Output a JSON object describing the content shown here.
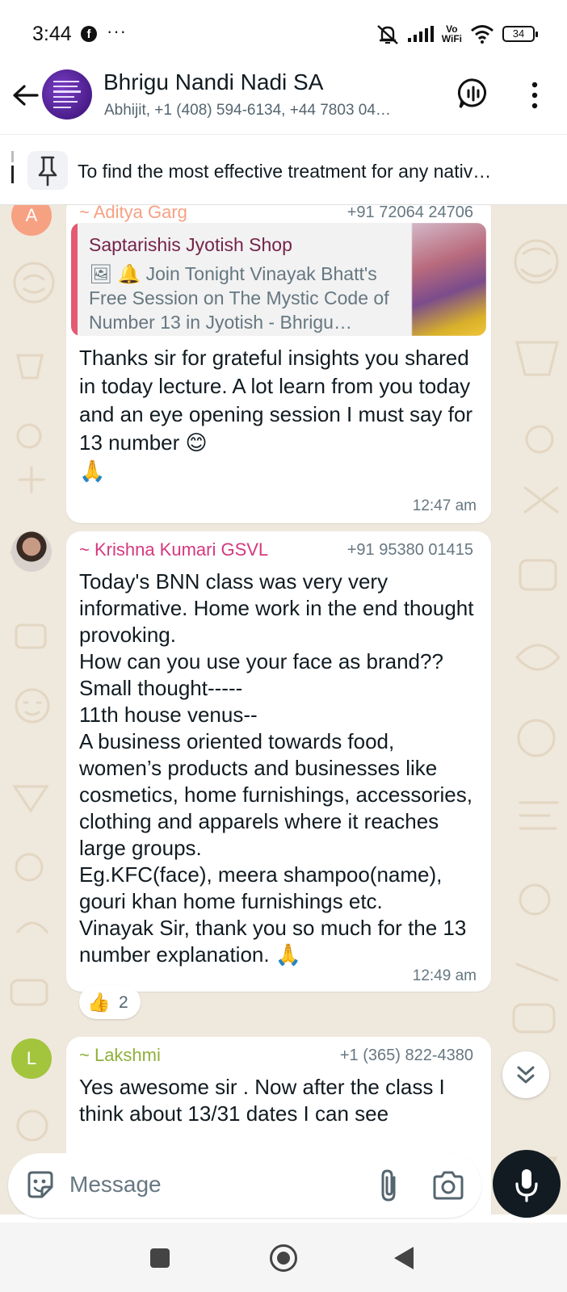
{
  "status_bar": {
    "time": "3:44",
    "app_badge": "f",
    "overflow": "···",
    "vowifi_top": "Vo",
    "vowifi_bottom": "WiFi",
    "battery": "34"
  },
  "header": {
    "title": "Bhrigu Nandi Nadi SA",
    "subtitle": "Abhijit, +1 (408) 594-6134, +44 7803 04…"
  },
  "pinned": {
    "text": "To find the most effective treatment for any nativ…"
  },
  "messages": [
    {
      "avatar_letter": "A",
      "avatar_color": "#f7a183",
      "sender": "~ Aditya Garg",
      "sender_color": "#f7a183",
      "phone": "+91 72064 24706",
      "quote": {
        "author": "Saptarishis Jyotish Shop",
        "text": "🖼 🔔 Join Tonight Vinayak Bhatt's Free Session on The Mystic Code of Number 13 in Jyotish - Bhrigu…"
      },
      "text": "Thanks sir for grateful insights you shared in today lecture. A lot learn from you today and an eye opening session I must say for 13 number 😊\n🙏",
      "time": "12:47 am"
    },
    {
      "sender": "~ Krishna Kumari GSVL",
      "sender_color": "#d4397f",
      "phone": "+91 95380 01415",
      "text": "Today's BNN class was very very informative. Home work in the end thought provoking.\nHow can you use your face as brand??\nSmall thought-----\n11th house venus--\n A business oriented towards food, women’s products and businesses like cosmetics, home furnishings, accessories, clothing and apparels where it reaches large groups.\nEg.KFC(face),  meera shampoo(name), gouri khan home furnishings etc.\nVinayak Sir, thank you so much for the 13 number explanation. 🙏",
      "time": "12:49 am",
      "reaction": {
        "emoji": "👍",
        "count": "2"
      }
    },
    {
      "avatar_letter": "L",
      "avatar_color": "#a3c43d",
      "sender": "~ Lakshmi",
      "sender_color": "#8fb03a",
      "phone": "+1 (365) 822-4380",
      "text": "Yes awesome sir . Now after the class I think about 13/31 dates I can see"
    }
  ],
  "composer": {
    "placeholder": "Message"
  },
  "icons": {
    "back": "arrow-left-icon",
    "voice_chat": "voice-chat-icon",
    "menu": "more-vertical-icon",
    "pin": "pin-icon",
    "sticker": "sticker-icon",
    "attach": "paperclip-icon",
    "camera": "camera-icon",
    "mic": "microphone-icon",
    "scroll_down": "double-chevron-down-icon"
  },
  "colors": {
    "wallpaper": "#efe8dc",
    "bubble": "#ffffff",
    "quote_accent": "#e35a72",
    "mic_button": "#111b21"
  }
}
